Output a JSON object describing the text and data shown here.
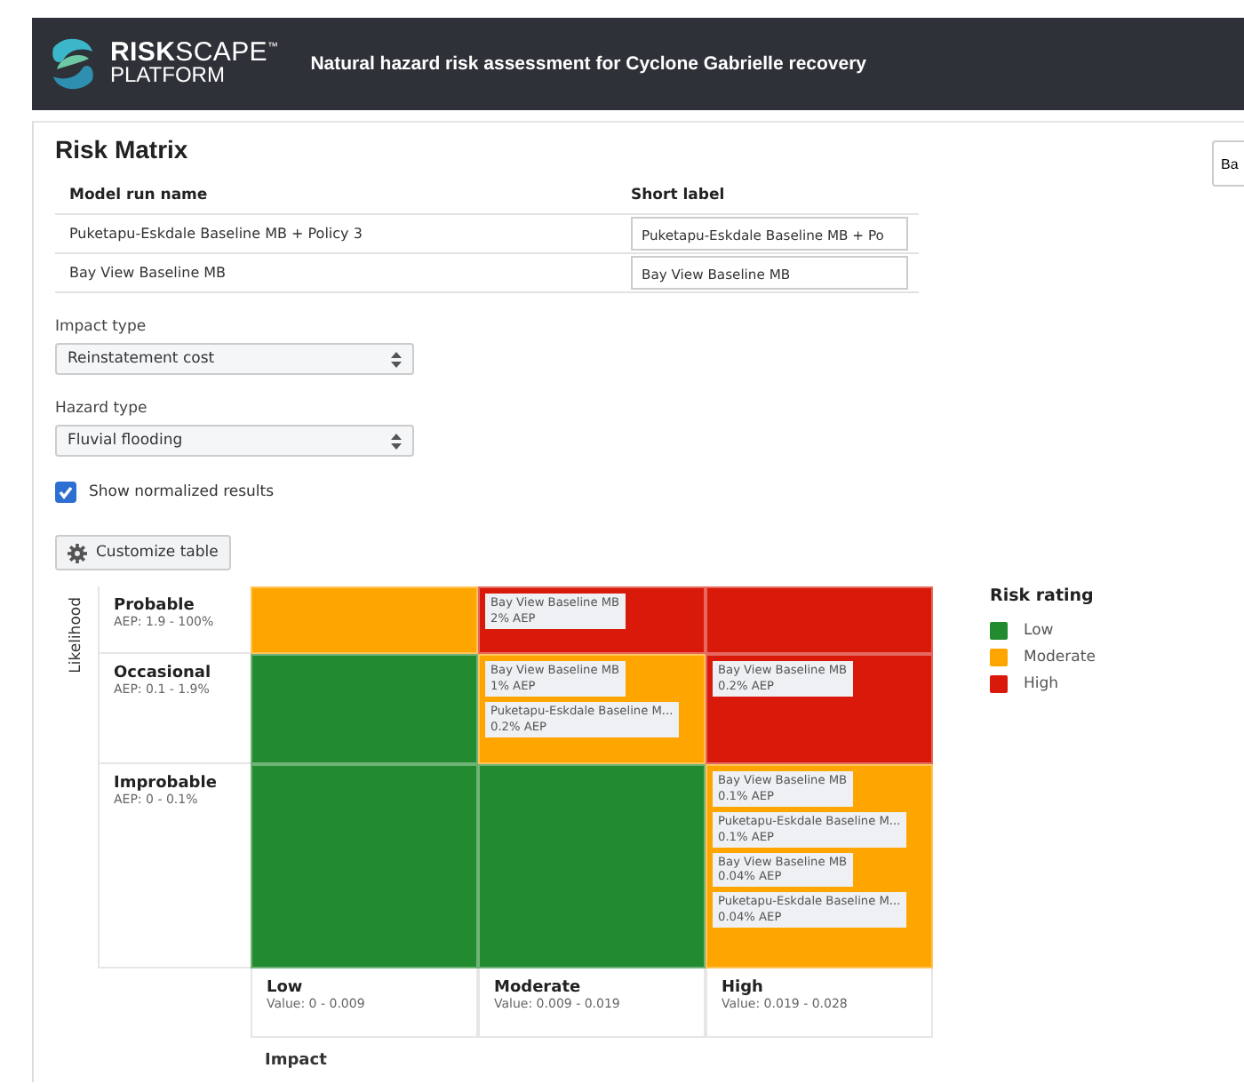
{
  "header": {
    "logo_top": "**RISK**SCAPE$^{™}$",
    "logo_bottom": "PLATFORM",
    "title": "Natural hazard risk assessment for Cyclone Gabrielle recovery"
  },
  "page": {
    "title": "Risk Matrix",
    "side_button": "Ba"
  },
  "model_runs": {
    "columns": [
      "Model run name",
      "Short label"
    ],
    "rows": [
      {
        "name": "Puketapu-Eskdale Baseline MB + Policy 3",
        "short_label": "Puketapu-Eskdale Baseline MB + Po"
      },
      {
        "name": "Bay View Baseline MB",
        "short_label": "Bay View Baseline MB"
      }
    ]
  },
  "selects": [
    {
      "label": "Impact type",
      "value": "Reinstatement cost"
    },
    {
      "label": "Hazard type",
      "value": "Fluvial flooding"
    }
  ],
  "normalize": {
    "label": "Show normalized results",
    "checked": true
  },
  "customize_button": "Customize table",
  "matrix": {
    "y_label": "Likelihood",
    "x_label": "Impact",
    "likelihood_levels": [
      {
        "label": "Probable",
        "range": "AEP: 1.9 - 100%",
        "zones": [
          {
            "color": "#ffa500"
          },
          {
            "color": "#d91a0b",
            "entries": [
              {
                "name": "Bay View Baseline MB",
                "aep": "2% AEP"
              }
            ]
          },
          {
            "color": "#d91a0b"
          }
        ]
      },
      {
        "label": "Occasional",
        "range": "AEP: 0.1 - 1.9%",
        "zones": [
          {
            "color": "#228b2f"
          },
          {
            "color": "#ffa500",
            "entries": [
              {
                "name": "Bay View Baseline MB",
                "aep": "1% AEP"
              },
              {
                "name": "Puketapu-Eskdale Baseline M...",
                "aep": "0.2% AEP"
              }
            ]
          },
          {
            "color": "#d91a0b",
            "entries": [
              {
                "name": "Bay View Baseline MB",
                "aep": "0.2% AEP"
              }
            ]
          }
        ]
      },
      {
        "label": "Improbable",
        "range": "AEP: 0 - 0.1%",
        "zones": [
          {
            "color": "#228b2f"
          },
          {
            "color": "#228b2f"
          },
          {
            "color": "#ffa500",
            "entries": [
              {
                "name": "Bay View Baseline MB",
                "aep": "0.1% AEP"
              },
              {
                "name": "Puketapu-Eskdale Baseline M...",
                "aep": "0.1% AEP"
              },
              {
                "name": "Bay View Baseline MB",
                "aep": "0.04% AEP"
              },
              {
                "name": "Puketapu-Eskdale Baseline M...",
                "aep": "0.04% AEP"
              }
            ]
          }
        ]
      }
    ],
    "impact_levels": [
      {
        "label": "Low",
        "range": "Value: 0 - 0.009"
      },
      {
        "label": "Moderate",
        "range": "Value: 0.009 - 0.019"
      },
      {
        "label": "High",
        "range": "Value: 0.019 - 0.028"
      }
    ]
  },
  "legend": {
    "title": "Risk rating",
    "items": [
      {
        "label": "Low",
        "color": "#228b2f"
      },
      {
        "label": "Moderate",
        "color": "#ffa500"
      },
      {
        "label": "High",
        "color": "#d91a0b"
      }
    ]
  }
}
